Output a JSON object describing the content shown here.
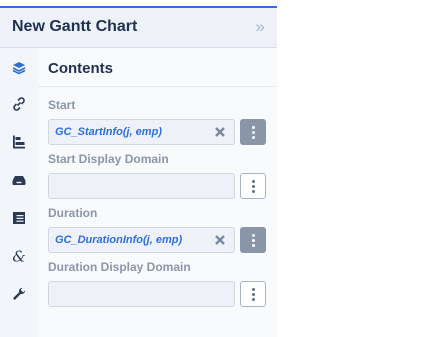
{
  "panel": {
    "title": "New Gantt Chart",
    "collapse_glyph": "»",
    "accent_color": "#2f6fd6"
  },
  "rail": {
    "items": [
      {
        "name": "layers-icon",
        "active": true
      },
      {
        "name": "link-icon",
        "active": false
      },
      {
        "name": "gantt-bars-icon",
        "active": false
      },
      {
        "name": "tray-icon",
        "active": false
      },
      {
        "name": "table-icon",
        "active": false
      },
      {
        "name": "ampersand-icon",
        "active": false
      },
      {
        "name": "wrench-icon",
        "active": false
      }
    ]
  },
  "content": {
    "title": "Contents",
    "fields": [
      {
        "label": "Start",
        "value": "GC_StartInfo(j, emp)",
        "has_value": true
      },
      {
        "label": "Start Display Domain",
        "value": "",
        "has_value": false
      },
      {
        "label": "Duration",
        "value": "GC_DurationInfo(j, emp)",
        "has_value": true
      },
      {
        "label": "Duration Display Domain",
        "value": "",
        "has_value": false
      }
    ]
  }
}
